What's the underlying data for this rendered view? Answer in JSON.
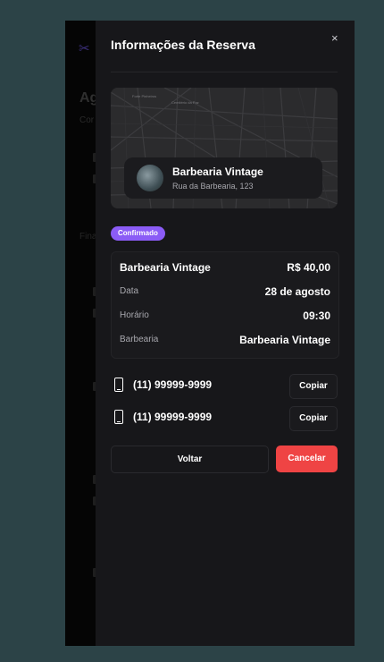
{
  "background_app": {
    "title_fragment": "Ag",
    "subtitle_fragment": "Cor",
    "section_fragment": "Fina"
  },
  "sheet": {
    "title": "Informações da Reserva",
    "close_label": "×"
  },
  "map": {
    "labels": [
      "Forte Pinheiros",
      "Cemitério da Paz"
    ],
    "place": {
      "name": "Barbearia Vintage",
      "address": "Rua da Barbearia, 123"
    }
  },
  "status_badge": "Confirmado",
  "details": {
    "service_name": "Barbearia Vintage",
    "price": "R$ 40,00",
    "rows": [
      {
        "label": "Data",
        "value": "28 de agosto"
      },
      {
        "label": "Horário",
        "value": "09:30"
      },
      {
        "label": "Barbearia",
        "value": "Barbearia Vintage"
      }
    ]
  },
  "phones": [
    {
      "number": "(11) 99999-9999",
      "copy_label": "Copiar"
    },
    {
      "number": "(11) 99999-9999",
      "copy_label": "Copiar"
    }
  ],
  "actions": {
    "back_label": "Voltar",
    "cancel_label": "Cancelar"
  },
  "colors": {
    "badge": "#8b5cf6",
    "cancel": "#ef4444",
    "sheet_bg": "#17171a",
    "page_bg": "#2c4347"
  }
}
